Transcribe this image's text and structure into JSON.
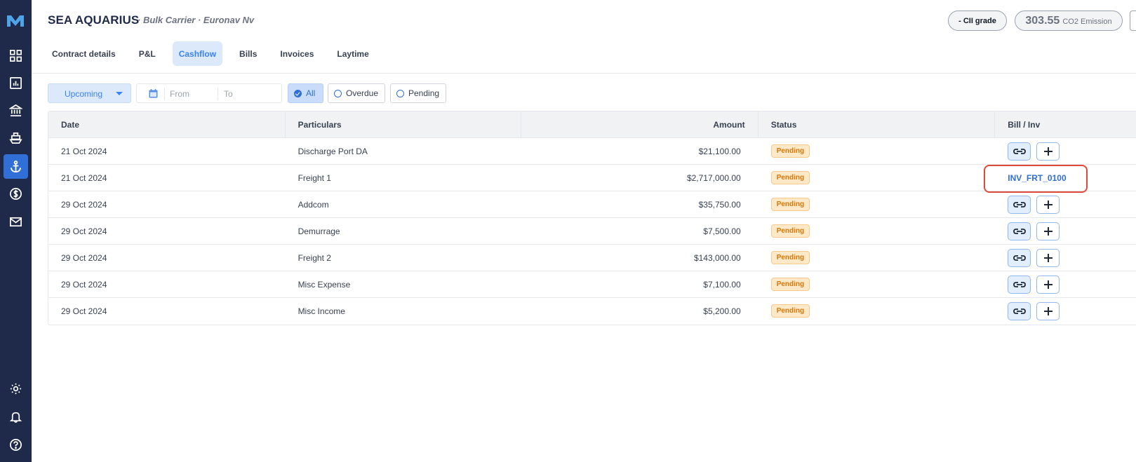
{
  "sidebar": {
    "items": [
      {
        "icon": "dashboard-grid-icon"
      },
      {
        "icon": "report-chart-icon"
      },
      {
        "icon": "bank-icon"
      },
      {
        "icon": "ship-icon"
      },
      {
        "icon": "anchor-icon",
        "active": true
      },
      {
        "icon": "dollar-circle-icon"
      },
      {
        "icon": "mail-icon"
      }
    ],
    "bottom": [
      {
        "icon": "gear-icon"
      },
      {
        "icon": "bell-icon"
      },
      {
        "icon": "help-icon"
      }
    ]
  },
  "header": {
    "title": "SEA AQUARIUS",
    "subtitle": "· Bulk Carrier · Euronav Nv",
    "cii_label": "- CII grade",
    "co2_value": "303.55",
    "co2_label": "CO2 Emission"
  },
  "tabs": [
    {
      "label": "Contract details"
    },
    {
      "label": "P&L"
    },
    {
      "label": "Cashflow",
      "active": true
    },
    {
      "label": "Bills"
    },
    {
      "label": "Invoices"
    },
    {
      "label": "Laytime"
    }
  ],
  "filters": {
    "period": "Upcoming",
    "from_placeholder": "From",
    "to_placeholder": "To",
    "status_all": "All",
    "status_overdue": "Overdue",
    "status_pending": "Pending"
  },
  "table": {
    "headers": [
      "Date",
      "Particulars",
      "Amount",
      "Status",
      "Bill / Inv"
    ],
    "rows": [
      {
        "date": "21 Oct 2024",
        "particulars": "Discharge Port DA",
        "amount": "$21,100.00",
        "status": "Pending",
        "bill": ""
      },
      {
        "date": "21 Oct 2024",
        "particulars": "Freight 1",
        "amount": "$2,717,000.00",
        "status": "Pending",
        "bill": "INV_FRT_0100"
      },
      {
        "date": "29 Oct 2024",
        "particulars": "Addcom",
        "amount": "$35,750.00",
        "status": "Pending",
        "bill": ""
      },
      {
        "date": "29 Oct 2024",
        "particulars": "Demurrage",
        "amount": "$7,500.00",
        "status": "Pending",
        "bill": ""
      },
      {
        "date": "29 Oct 2024",
        "particulars": "Freight 2",
        "amount": "$143,000.00",
        "status": "Pending",
        "bill": ""
      },
      {
        "date": "29 Oct 2024",
        "particulars": "Misc Expense",
        "amount": "$7,100.00",
        "status": "Pending",
        "bill": ""
      },
      {
        "date": "29 Oct 2024",
        "particulars": "Misc Income",
        "amount": "$5,200.00",
        "status": "Pending",
        "bill": ""
      }
    ]
  },
  "colors": {
    "sidebar_bg": "#1f2a4a",
    "accent": "#2f6fd6",
    "pending_badge": "#d97706",
    "highlight": "#e04a3a"
  }
}
